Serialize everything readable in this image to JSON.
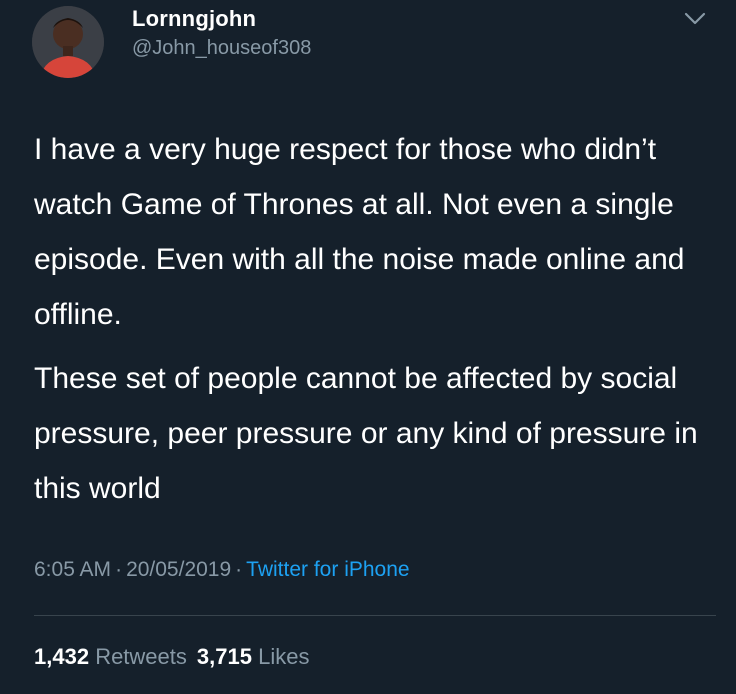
{
  "user": {
    "display_name": "Lornngjohn",
    "handle": "@John_houseof308",
    "avatar_icon": "profile-photo"
  },
  "menu": {
    "icon": "chevron-down-icon"
  },
  "tweet": {
    "paragraphs": [
      "I have a very huge respect for those who didn’t watch Game of Thrones at all. Not even a single episode. Even with all the noise made online and offline.",
      "These set of people cannot be affected by social pressure, peer pressure or any kind of pressure in this world"
    ]
  },
  "meta": {
    "time": "6:05 AM",
    "separator": "·",
    "date": "20/05/2019",
    "source": "Twitter for iPhone"
  },
  "stats": {
    "retweets_count": "1,432",
    "retweets_label": "Retweets",
    "likes_count": "3,715",
    "likes_label": "Likes"
  },
  "colors": {
    "background": "#15202b",
    "text": "#ffffff",
    "secondary": "#8899a6",
    "accent": "#1da1f2",
    "divider": "#38444d"
  }
}
